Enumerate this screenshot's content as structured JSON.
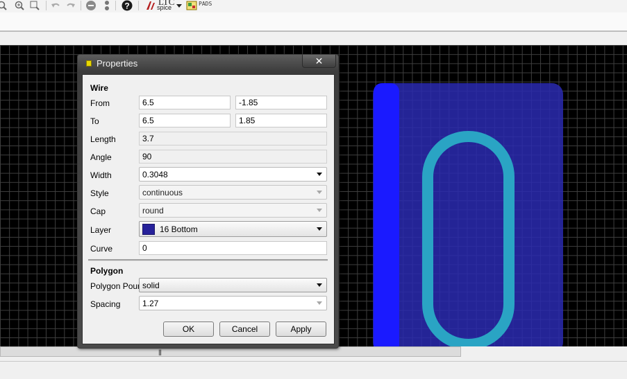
{
  "toolbar": {
    "icons": [
      "zoom-out-icon",
      "zoom-in-icon",
      "zoom-fit-icon",
      "undo-icon",
      "redo-icon",
      "stop-icon",
      "drc-icon",
      "help-icon",
      "ltspice-icon",
      "dropdown-icon",
      "pads-icon"
    ],
    "ltspice_logo": "LTC",
    "ltspice_sub": "spice",
    "pads_label": "PADS"
  },
  "dialog": {
    "title": "Properties",
    "close_label": "✕",
    "wire": {
      "heading": "Wire",
      "from_label": "From",
      "from_x": "6.5",
      "from_y": "-1.85",
      "to_label": "To",
      "to_x": "6.5",
      "to_y": "1.85",
      "length_label": "Length",
      "length": "3.7",
      "angle_label": "Angle",
      "angle": "90",
      "width_label": "Width",
      "width": "0.3048",
      "style_label": "Style",
      "style": "continuous",
      "cap_label": "Cap",
      "cap": "round",
      "layer_label": "Layer",
      "layer": "16 Bottom",
      "layer_color": "#26219a",
      "curve_label": "Curve",
      "curve": "0"
    },
    "polygon": {
      "heading": "Polygon",
      "pour_label": "Polygon Pour",
      "pour": "solid",
      "spacing_label": "Spacing",
      "spacing": "1.27"
    },
    "buttons": {
      "ok": "OK",
      "cancel": "Cancel",
      "apply": "Apply"
    }
  },
  "canvas": {
    "background": "#000000",
    "grid_color": "#3f3f3f",
    "polygon_fill": "#2a2ab0",
    "wire_color": "#1a1aff",
    "outline_color": "#2aa4c4"
  },
  "scrollbar": {
    "grip": "|||"
  }
}
